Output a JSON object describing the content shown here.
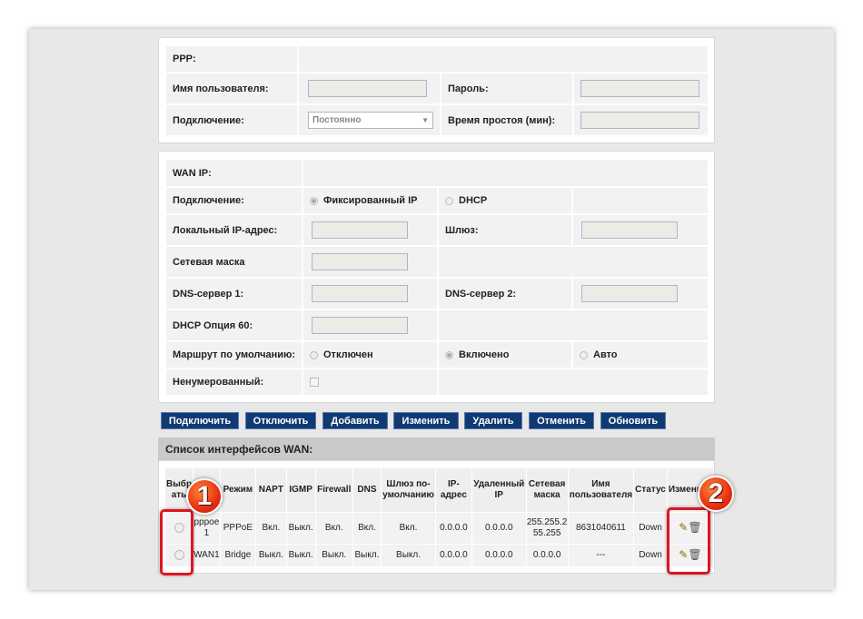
{
  "ppp": {
    "title": "PPP:",
    "username_label": "Имя пользователя:",
    "password_label": "Пароль:",
    "connection_label": "Подключение:",
    "connection_value": "Постоянно",
    "idle_label": "Время простоя (мин):"
  },
  "wanip": {
    "title": "WAN IP:",
    "connection_label": "Подключение:",
    "opt_static": "Фиксированный IP",
    "opt_dhcp": "DHCP",
    "local_ip_label": "Локальный IP-адрес:",
    "gateway_label": "Шлюз:",
    "mask_label": "Сетевая маска",
    "dns1_label": "DNS-сервер 1:",
    "dns2_label": "DNS-сервер 2:",
    "dhcp60_label": "DHCP Опция 60:",
    "default_route_label": "Маршрут по умолчанию:",
    "route_off": "Отключен",
    "route_on": "Включено",
    "route_auto": "Авто",
    "unnumbered_label": "Ненумерованный:"
  },
  "buttons": [
    "Подключить",
    "Отключить",
    "Добавить",
    "Изменить",
    "Удалить",
    "Отменить",
    "Обновить"
  ],
  "wan_list": {
    "title": "Список интерфейсов WAN:",
    "columns": [
      "Выбр ать",
      "Имя",
      "Режим",
      "NAPT",
      "IGMP",
      "Firewall",
      "DNS",
      "Шлюз по-умолчанию",
      "IP-адрес",
      "Удаленный IP",
      "Сетевая маска",
      "Имя пользователя",
      "Статус",
      "Изменить"
    ],
    "rows": [
      [
        "",
        "pppoe 1",
        "PPPoE",
        "Вкл.",
        "Выкл.",
        "Вкл.",
        "Вкл.",
        "Вкл.",
        "0.0.0.0",
        "0.0.0.0",
        "255.255.255.255",
        "8631040611",
        "Down"
      ],
      [
        "",
        "WAN1",
        "Bridge",
        "Выкл.",
        "Выкл.",
        "Выкл.",
        "Выкл.",
        "Выкл.",
        "0.0.0.0",
        "0.0.0.0",
        "0.0.0.0",
        "---",
        "Down"
      ]
    ]
  },
  "annotations": {
    "badge1": "1",
    "badge2": "2",
    "color": "#e0141e"
  }
}
